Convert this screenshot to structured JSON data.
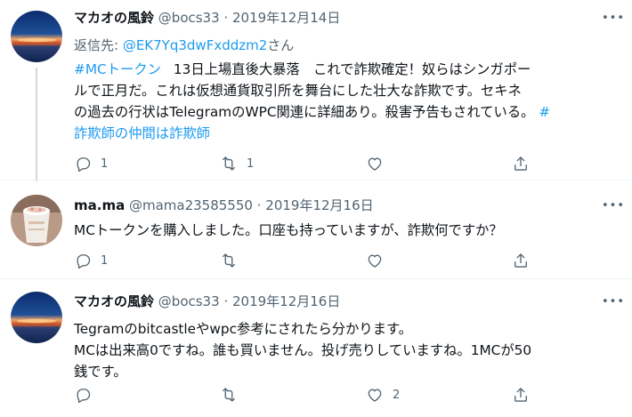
{
  "tweets": [
    {
      "name": "マカオの風鈴",
      "handle": "@bocs33",
      "separator": "·",
      "date": "2019年12月14日",
      "more": "•••",
      "reply_prefix": "返信先: ",
      "reply_mention": "@EK7Yq3dwFxddzm2",
      "reply_suffix": "さん",
      "body": {
        "hashtag1": "#MCトークン",
        "line1_rest": "13日上場直後大暴落　これで詐欺確定！奴らはシンガポー",
        "line2": "ルで正月だ。これは仮想通貨取引所を舞台にした壮大な詐欺です。セキネ",
        "line3": "の過去の行状はTelegramのWPC関連に詳細あり。殺害予告もされている。",
        "hashtag2a": "#",
        "hashtag2b": "詐欺師の仲間は詐欺師"
      },
      "counts": {
        "reply": "1",
        "retweet": "1",
        "like": "",
        "share": ""
      }
    },
    {
      "name": "ma.ma",
      "handle": "@mama23585550",
      "separator": "·",
      "date": "2019年12月16日",
      "more": "•••",
      "body": {
        "line1": "MCトークンを購入しました。口座も持っていますが、詐欺何ですか？"
      },
      "counts": {
        "reply": "1",
        "retweet": "",
        "like": "",
        "share": ""
      }
    },
    {
      "name": "マカオの風鈴",
      "handle": "@bocs33",
      "separator": "·",
      "date": "2019年12月16日",
      "more": "•••",
      "body": {
        "line1": "Tegramのbitcastleやwpc参考にされたら分かります。",
        "line2": "MCは出来高0ですね。誰も買いません。投げ売りしていますね。1MCが50",
        "line3": "銭です。"
      },
      "counts": {
        "reply": "",
        "retweet": "",
        "like": "2",
        "share": ""
      }
    }
  ],
  "icons": {
    "reply": "reply-icon",
    "retweet": "retweet-icon",
    "like": "heart-icon",
    "share": "share-icon"
  },
  "colors": {
    "link": "#1d9bf0",
    "secondary_text": "#536471",
    "primary_text": "#0f1419",
    "thread_line": "#cfd9de"
  }
}
